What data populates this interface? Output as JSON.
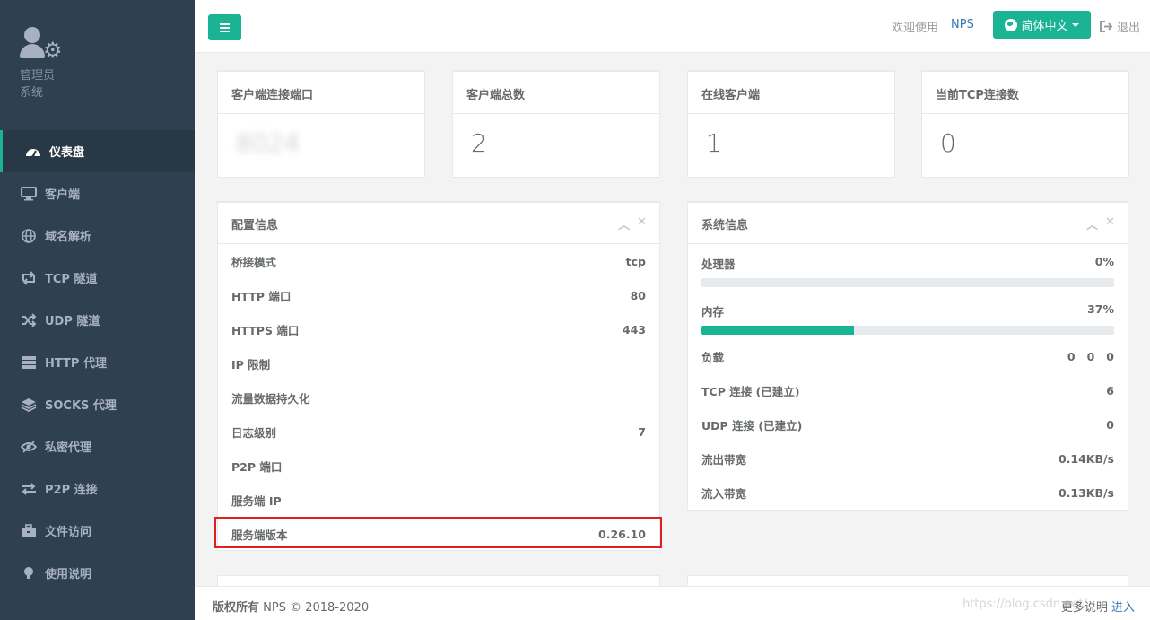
{
  "sidebar": {
    "profile_name": "管理员",
    "profile_role": "系统",
    "items": [
      {
        "label": "仪表盘",
        "icon": "dashboard-icon",
        "active": true
      },
      {
        "label": "客户端",
        "icon": "desktop-icon"
      },
      {
        "label": "域名解析",
        "icon": "globe-icon"
      },
      {
        "label": "TCP 隧道",
        "icon": "retweet-icon"
      },
      {
        "label": "UDP 隧道",
        "icon": "random-icon"
      },
      {
        "label": "HTTP 代理",
        "icon": "server-icon"
      },
      {
        "label": "SOCKS 代理",
        "icon": "layers-icon"
      },
      {
        "label": "私密代理",
        "icon": "eye-slash-icon"
      },
      {
        "label": "P2P 连接",
        "icon": "exchange-icon"
      },
      {
        "label": "文件访问",
        "icon": "briefcase-icon"
      },
      {
        "label": "使用说明",
        "icon": "lightbulb-icon"
      }
    ]
  },
  "topbar": {
    "menu_icon": "hamburger-icon",
    "welcome": "欢迎使用",
    "app_name": "NPS",
    "language": "简体中文",
    "logout": "退出"
  },
  "stats": [
    {
      "title": "客户端连接端口",
      "value": "8024"
    },
    {
      "title": "客户端总数",
      "value": "2"
    },
    {
      "title": "在线客户端",
      "value": "1"
    },
    {
      "title": "当前TCP连接数",
      "value": "0"
    }
  ],
  "config_panel": {
    "title": "配置信息",
    "rows": [
      {
        "label": "桥接模式",
        "value": "tcp"
      },
      {
        "label": "HTTP 端口",
        "value": "80"
      },
      {
        "label": "HTTPS 端口",
        "value": "443"
      },
      {
        "label": "IP 限制",
        "value": ""
      },
      {
        "label": "流量数据持久化",
        "value": ""
      },
      {
        "label": "日志级别",
        "value": "7"
      },
      {
        "label": "P2P 端口",
        "value": ""
      },
      {
        "label": "服务端 IP",
        "value": ""
      },
      {
        "label": "服务端版本",
        "value": "0.26.10"
      }
    ]
  },
  "system_panel": {
    "title": "系统信息",
    "cpu": {
      "label": "处理器",
      "value": "0%",
      "fraction": 0.0
    },
    "memory": {
      "label": "内存",
      "value": "37%",
      "fraction": 0.37
    },
    "load": {
      "label": "负载",
      "values": [
        "0",
        "0",
        "0"
      ]
    },
    "rows": [
      {
        "label": "TCP 连接 (已建立)",
        "value": "6"
      },
      {
        "label": "UDP 连接 (已建立)",
        "value": "0"
      },
      {
        "label": "流出带宽",
        "value": "0.14KB/s"
      },
      {
        "label": "流入带宽",
        "value": "0.13KB/s"
      }
    ]
  },
  "footer": {
    "copyright_label": "版权所有",
    "copyright_text": "NPS © 2018-2020",
    "more_label": "更多说明",
    "more_link": "进入",
    "watermark": "https://blog.csdn.net/"
  },
  "colors": {
    "accent": "#1ab394",
    "sidebar_bg": "#2f4050",
    "link": "#337ab7",
    "highlight_border": "#e02020"
  }
}
